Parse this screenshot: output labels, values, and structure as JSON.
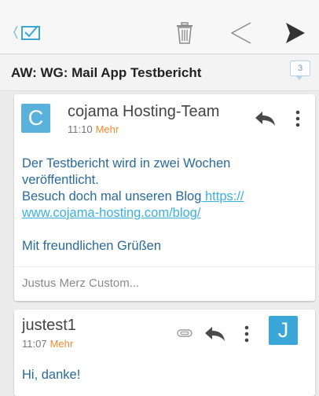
{
  "colors": {
    "accent_orange": "#ef8c2f",
    "link_blue": "#3ab0e0",
    "body_blue": "#2a6a9b",
    "avatar_blue": "#3aa7d8"
  },
  "toolbar": {
    "back_icon": "back-to-inbox-icon",
    "trash_icon": "trash-icon",
    "prev_icon": "previous-triangle-icon",
    "next_icon": "next-triangle-icon"
  },
  "thread": {
    "subject": "AW: WG: Mail App Testbericht",
    "count": "3"
  },
  "messages": [
    {
      "avatar_letter": "C",
      "sender": "cojama Hosting-Team",
      "time": "11:10",
      "more_label": "Mehr",
      "body": {
        "line1": "Der Testbericht wird in zwei Wochen veröffentlicht.",
        "line2_prefix": "Besuch doch mal unseren Blog",
        "link": " https://\nwww.cojama-hosting.com/blog/",
        "greeting": "Mit freundlichen Grüßen"
      },
      "preview": "Justus Merz Custom..."
    },
    {
      "avatar_letter": "J",
      "sender": "justest1",
      "time": "11:07",
      "more_label": "Mehr",
      "body": {
        "line1": "Hi, danke!"
      }
    }
  ]
}
